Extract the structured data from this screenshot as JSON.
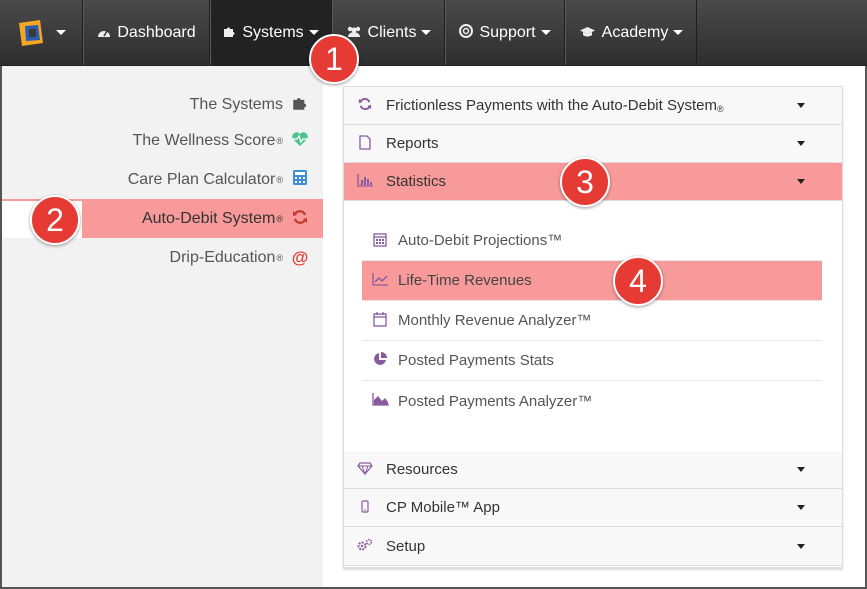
{
  "navbar": {
    "logo_icon": "cp-logo-icon",
    "items": [
      {
        "label": "Dashboard",
        "icon": "dashboard-icon"
      },
      {
        "label": "Systems",
        "icon": "puzzle-icon"
      },
      {
        "label": "Clients",
        "icon": "users-icon"
      },
      {
        "label": "Support",
        "icon": "lifebuoy-icon"
      },
      {
        "label": "Academy",
        "icon": "graduation-cap-icon"
      }
    ]
  },
  "sidebar": {
    "items": [
      {
        "label": "The Systems",
        "reg": "",
        "icon": "puzzle-icon"
      },
      {
        "label": "The Wellness Score",
        "reg": "®",
        "icon": "heartbeat-icon"
      },
      {
        "label": "Care Plan Calculator",
        "reg": "®",
        "icon": "calculator-icon"
      },
      {
        "label": "Auto-Debit System",
        "reg": "®",
        "icon": "refresh-icon"
      },
      {
        "label": "Drip-Education",
        "reg": "®",
        "icon": "at-icon"
      }
    ]
  },
  "panel": {
    "sections": [
      {
        "label": "Frictionless Payments with the Auto-Debit System",
        "reg": "®",
        "icon": "refresh-icon"
      },
      {
        "label": "Reports",
        "reg": "",
        "icon": "file-icon"
      },
      {
        "label": "Statistics",
        "reg": "",
        "icon": "bar-chart-icon"
      },
      {
        "label": "Resources",
        "reg": "",
        "icon": "diamond-icon"
      },
      {
        "label": "CP Mobile™ App",
        "reg": "",
        "icon": "mobile-icon"
      },
      {
        "label": "Setup",
        "reg": "",
        "icon": "cogs-icon"
      }
    ],
    "statistics_items": [
      {
        "label": "Auto-Debit Projections™",
        "icon": "calendar-icon"
      },
      {
        "label": "Life-Time Revenues",
        "icon": "line-chart-icon"
      },
      {
        "label": "Monthly Revenue Analyzer™",
        "icon": "calendar-empty-icon"
      },
      {
        "label": "Posted Payments Stats",
        "icon": "pie-chart-icon"
      },
      {
        "label": "Posted Payments Analyzer™",
        "icon": "area-chart-icon"
      }
    ]
  },
  "callouts": [
    "1",
    "2",
    "3",
    "4"
  ],
  "colors": {
    "highlight": "#f89a9a",
    "callout": "#e63b35",
    "icon_purple": "#8a5a9e",
    "navbar": "#3a3a3a"
  }
}
